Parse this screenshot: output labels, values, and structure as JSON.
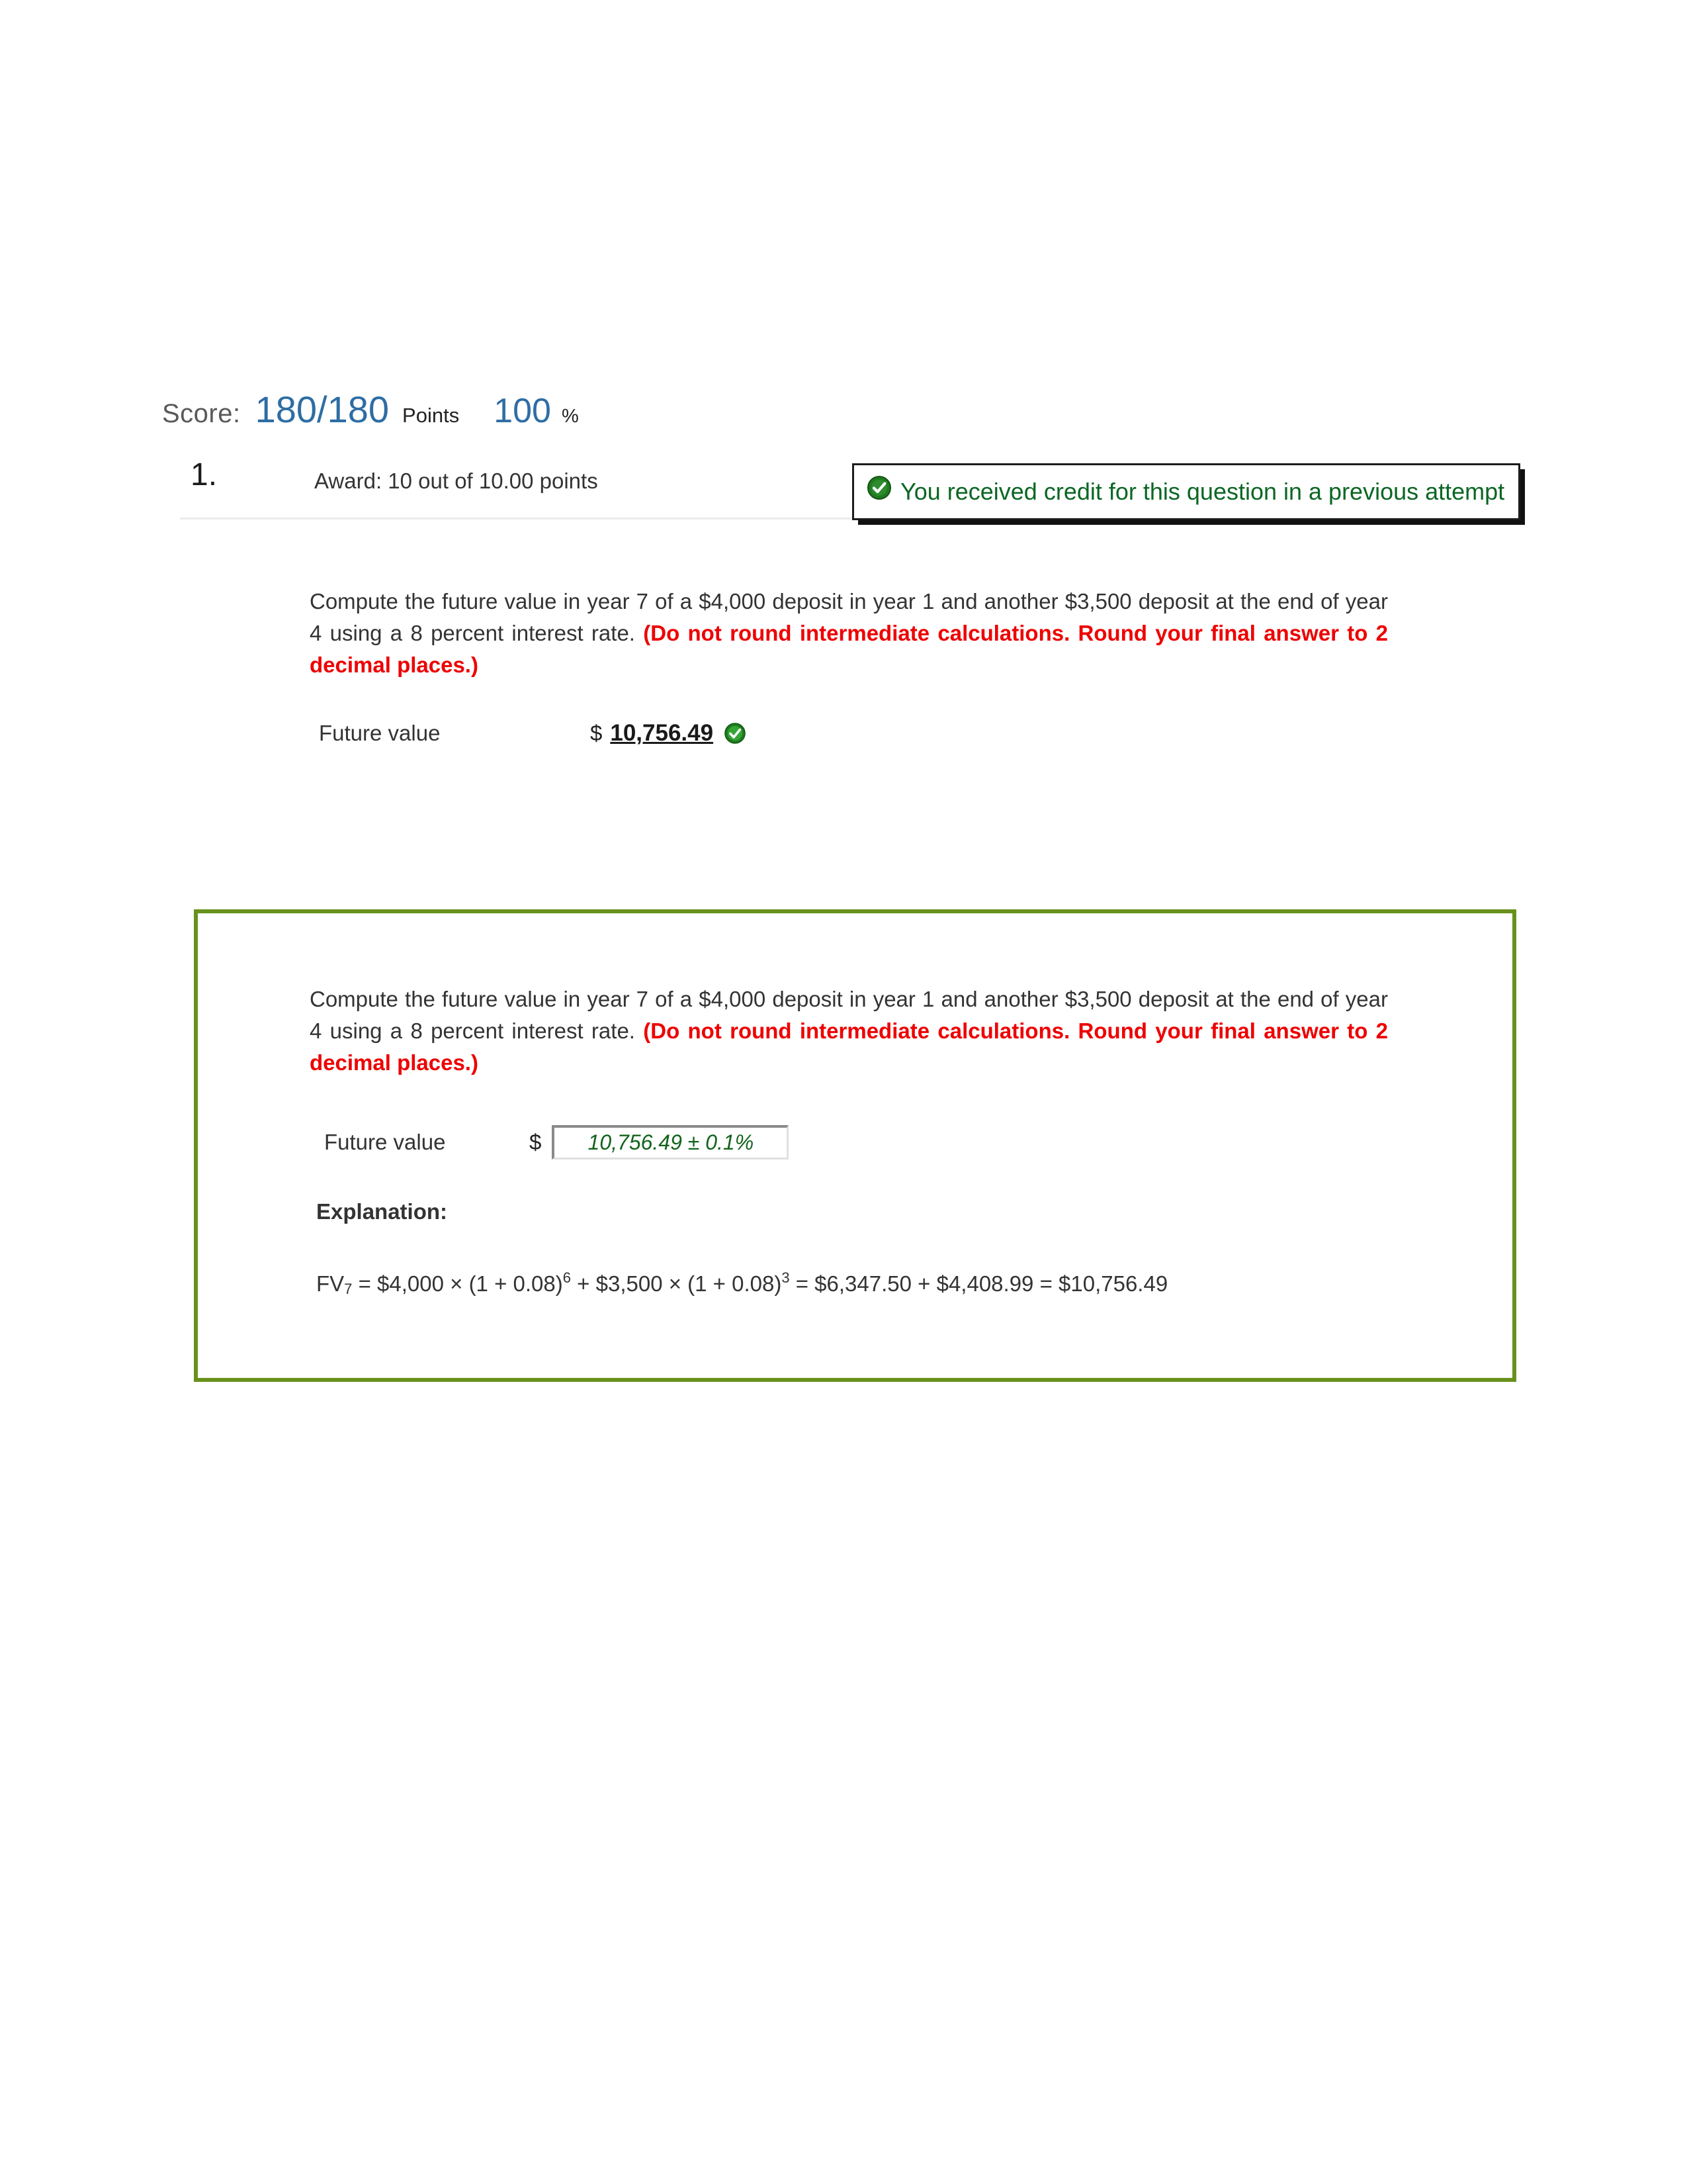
{
  "score": {
    "label": "Score:",
    "value": "180/180",
    "points_label": "Points",
    "percent_value": "100",
    "percent_sign": "%",
    "value_color": "#2e6da4"
  },
  "question": {
    "number": "1.",
    "award": "Award: 10 out of 10.00 points",
    "credit_banner": {
      "text": "You received credit for this question in a previous attempt",
      "icon": "check-circle-icon",
      "text_color": "#0b6623"
    },
    "prompt_plain": "Compute the future value in year 7 of a $4,000 deposit in year 1 and another $3,500 deposit at the end of year 4 using a 8 percent interest rate. ",
    "prompt_emphasis": "(Do not round intermediate calculations. Round your final answer to 2 decimal places.)",
    "emphasis_color": "#ee0000",
    "answer": {
      "label": "Future value",
      "currency": "$",
      "value": "10,756.49",
      "status_icon": "check-circle-icon"
    }
  },
  "explanation": {
    "border_color": "#68911c",
    "prompt_plain": "Compute the future value in year 7 of a $4,000 deposit in year 1 and another $3,500 deposit at the end of year 4 using a 8 percent interest rate. ",
    "prompt_emphasis": "(Do not round intermediate calculations. Round your final answer to 2 decimal places.)",
    "answer": {
      "label": "Future value",
      "currency": "$",
      "input_value": "10,756.49 ± 0.1%",
      "input_value_color": "#13631b"
    },
    "heading": "Explanation:",
    "formula": {
      "fv_symbol": "FV",
      "fv_subscript": "7",
      "part1_lead": " = $4,000 × (1 + 0.08)",
      "exp1": "6",
      "part2_lead": " + $3,500 × (1 + 0.08)",
      "exp2": "3",
      "tail": " = $6,347.50 + $4,408.99 = $10,756.49"
    }
  }
}
